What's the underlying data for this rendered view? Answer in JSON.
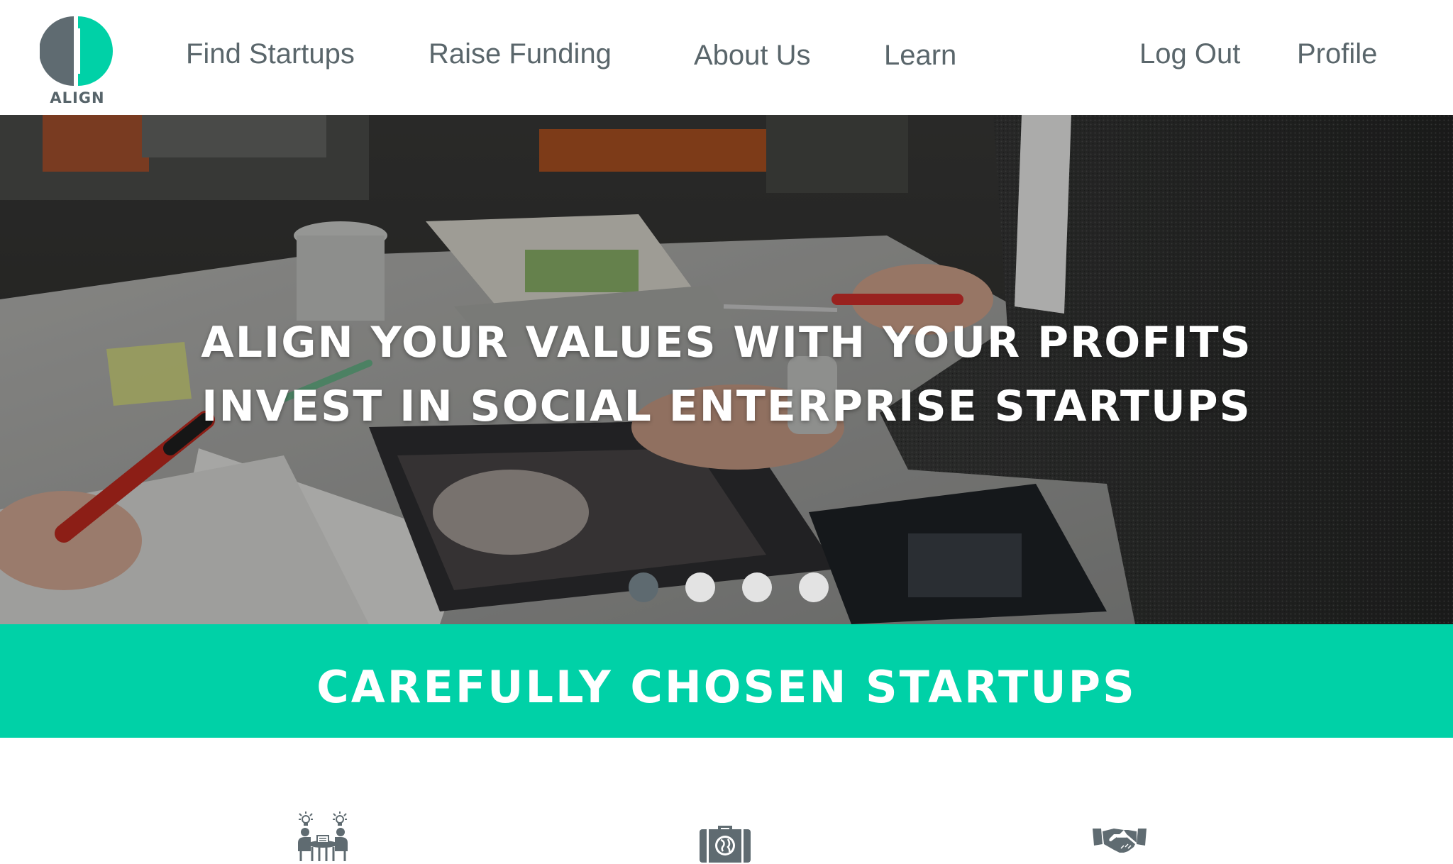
{
  "logo": {
    "text": "ALIGN",
    "colors": {
      "gray": "#5f6b71",
      "teal": "#00d1a7"
    }
  },
  "nav": {
    "find_startups": "Find Startups",
    "raise_funding": "Raise Funding",
    "about_us": "About Us",
    "learn": "Learn",
    "log_out": "Log Out",
    "profile": "Profile"
  },
  "hero": {
    "headline_line1": "ALIGN YOUR VALUES WITH YOUR PROFITS",
    "headline_line2": "INVEST IN SOCIAL ENTERPRISE STARTUPS",
    "carousel": {
      "slide_count": 4,
      "active_index": 0
    }
  },
  "band": {
    "title": "CAREFULLY CHOSEN STARTUPS"
  },
  "features": [
    {
      "icon": "team-meeting-icon"
    },
    {
      "icon": "briefcase-globe-icon"
    },
    {
      "icon": "handshake-icon"
    }
  ],
  "colors": {
    "accent": "#00d1a7",
    "text": "#5a666b",
    "dot_active": "#5e6a70",
    "dot_inactive": "#e3e3e3"
  }
}
